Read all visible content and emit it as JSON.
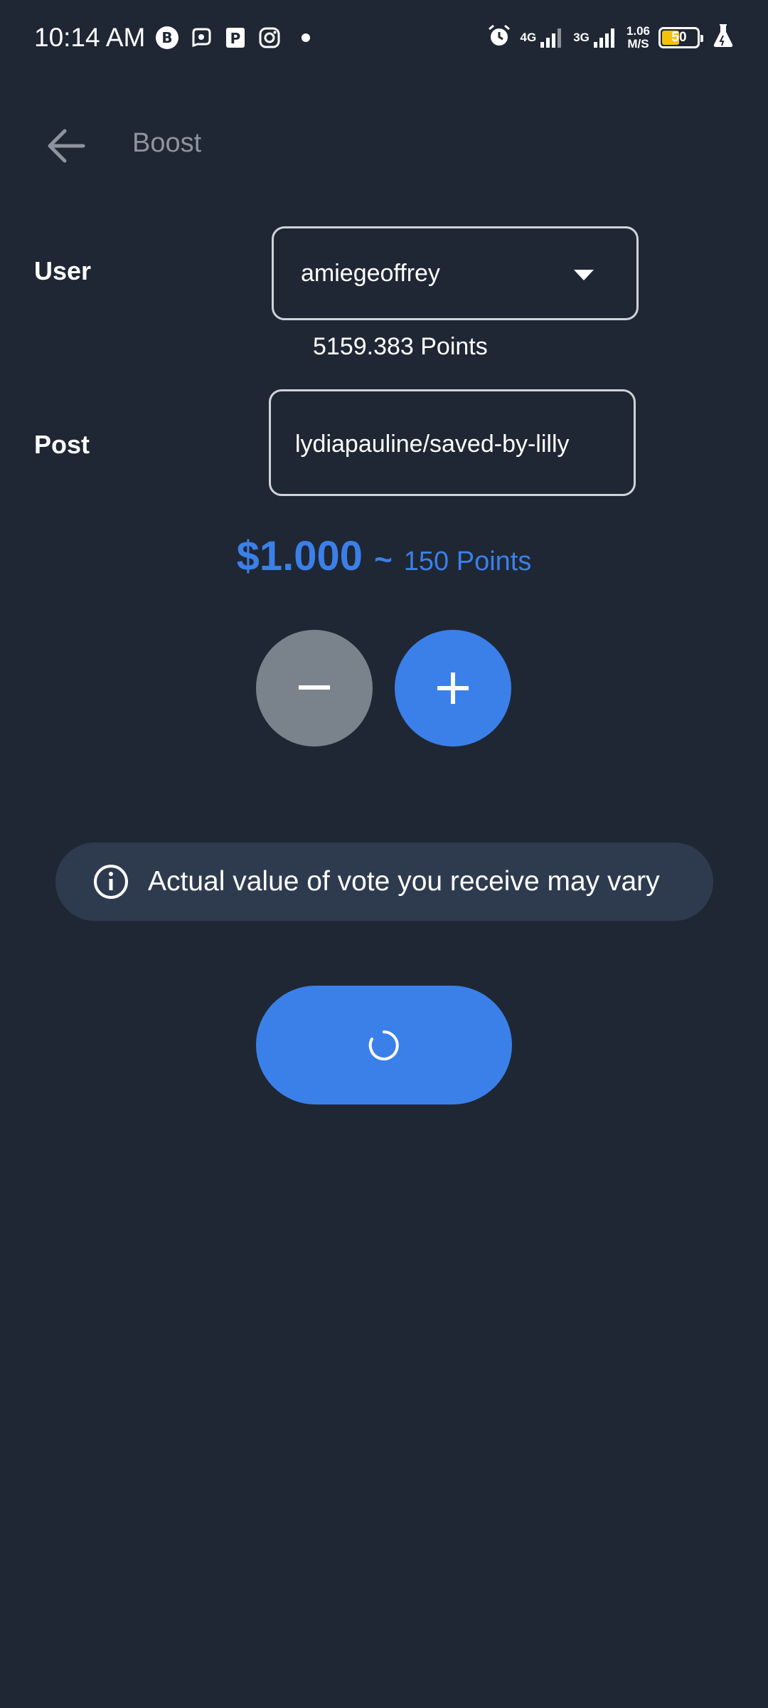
{
  "status_bar": {
    "time": "10:14 AM",
    "notification_icons": [
      "bitcoin-icon",
      "chat-app-icon",
      "parking-app-icon",
      "instagram-icon",
      "dot-icon"
    ],
    "network_1": "4G",
    "network_2": "3G",
    "speed_value": "1.06",
    "speed_unit": "M/S",
    "battery_percent": "50",
    "battery_level": 0.5
  },
  "app_bar": {
    "back_icon": "arrow-left-icon",
    "title": "Boost"
  },
  "form": {
    "user_label": "User",
    "user_value": "amiegeoffrey",
    "points_balance": "5159.383 Points",
    "post_label": "Post",
    "post_value": "lydiapauline/saved-by-lilly"
  },
  "amount": {
    "usd": "$1.000",
    "separator": "~",
    "points": "150 Points"
  },
  "controls": {
    "minus_icon": "minus-icon",
    "plus_icon": "plus-icon"
  },
  "info": {
    "icon": "info-icon",
    "text": "Actual value of vote you receive may vary"
  },
  "submit": {
    "state": "loading",
    "icon": "spinner-icon"
  },
  "colors": {
    "background": "#1f2734",
    "accent": "#3b80e8",
    "muted_button": "#7a838c",
    "banner": "#2e3b4f"
  }
}
